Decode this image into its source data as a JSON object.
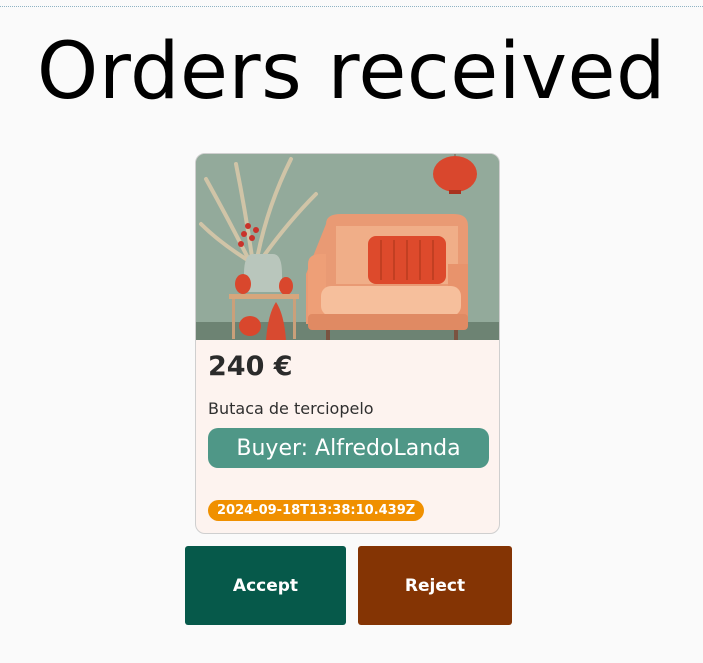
{
  "page": {
    "title": "Orders received"
  },
  "order": {
    "image_subject": "orange velvet armchair",
    "price": "240 €",
    "product_name": "Butaca de terciopelo",
    "buyer": "Buyer: AlfredoLanda",
    "timestamp": "2024-09-18T13:38:10.439Z"
  },
  "actions": {
    "accept_label": "Accept",
    "reject_label": "Reject"
  },
  "colors": {
    "buyer_badge": "#4f9787",
    "timestamp_badge": "#f09000",
    "accept_button": "#06594a",
    "reject_button": "#843404",
    "card_background": "#fdf3ef"
  }
}
